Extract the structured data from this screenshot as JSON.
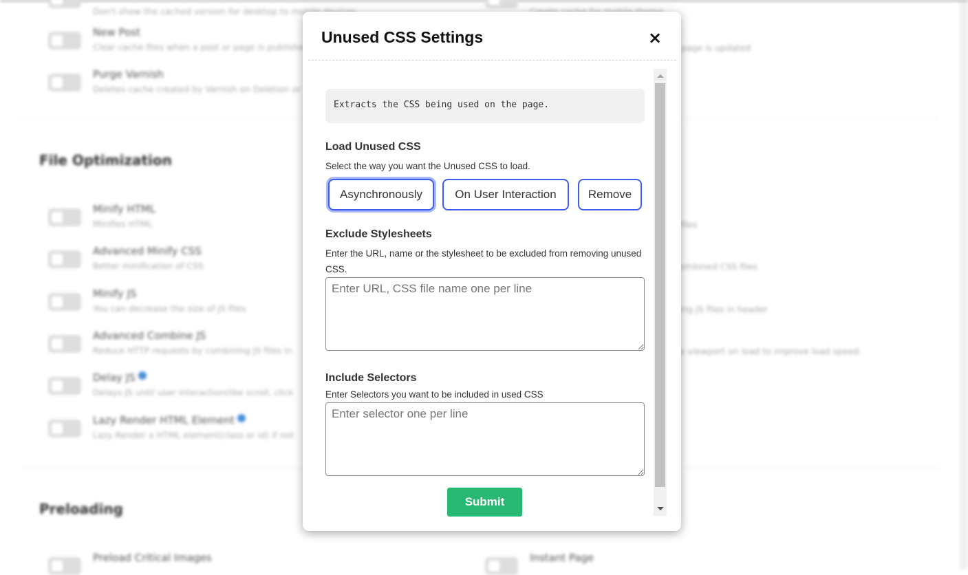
{
  "background": {
    "left_rows": [
      {
        "title": "",
        "desc": "Don't show the cached version for desktop to mobile devices"
      },
      {
        "title": "New Post",
        "desc": "Clear cache files when a post or page is published"
      },
      {
        "title": "Purge Varnish",
        "desc": "Deletes cache created by Varnish on Deletion or"
      }
    ],
    "right_rows": [
      {
        "desc": "Create cache for mobile theme"
      },
      {
        "desc": "page is updated"
      }
    ],
    "file_optimization": {
      "heading": "File Optimization",
      "left_rows": [
        {
          "title": "Minify HTML",
          "desc": "Minifies HTML"
        },
        {
          "title": "Advanced Minify CSS",
          "desc": "Better minification of CSS"
        },
        {
          "title": "Minify JS",
          "desc": "You can decrease the size of JS files"
        },
        {
          "title": "Advanced Combine JS",
          "desc": "Reduce HTTP requests by combining JS files in"
        },
        {
          "title": "Delay JS",
          "desc": "Delays JS until user interaction(like scroll, click"
        },
        {
          "title": "Lazy Render HTML Element",
          "desc": "Lazy Render a HTML element(class or id) if not"
        }
      ],
      "right_fragments": [
        "files",
        "ombined CSS files",
        "ing JS files in header",
        "e viewport on load to improve load speed."
      ]
    },
    "preloading": {
      "heading": "Preloading",
      "left_title": "Preload Critical Images",
      "right_title": "Instant Page"
    }
  },
  "modal": {
    "title": "Unused CSS Settings",
    "close_icon": "×",
    "info": "Extracts the CSS being used on the page.",
    "load": {
      "label": "Load Unused CSS",
      "desc": "Select the way you want the Unused CSS to load.",
      "options": [
        "Asynchronously",
        "On User Interaction",
        "Remove"
      ],
      "selected": "Asynchronously"
    },
    "exclude": {
      "label": "Exclude Stylesheets",
      "desc": "Enter the URL, name or the stylesheet to be excluded from removing unused CSS.",
      "placeholder": "Enter URL, CSS file name one per line",
      "value": ""
    },
    "include": {
      "label": "Include Selectors",
      "desc": "Enter Selectors you want to be included in used CSS",
      "placeholder": "Enter selector one per line",
      "value": ""
    },
    "submit_label": "Submit",
    "colors": {
      "accent": "#3f5cf0",
      "submit": "#27b873"
    }
  }
}
